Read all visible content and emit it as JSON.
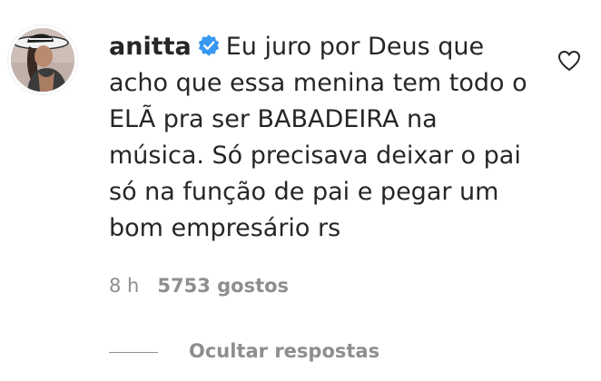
{
  "comment": {
    "username": "anitta",
    "avatar_icon": "user-avatar-photo",
    "verified_icon": "verified-badge-icon",
    "verified_color": "#3897f0",
    "lines": [
      "Eu juro por Deus que",
      "acho que essa menina tem todo o",
      "ELÃ pra ser BABADEIRA na",
      "música. Só precisava deixar o pai",
      "só na função de pai e pegar um",
      "bom empresário rs"
    ],
    "time": "8 h",
    "likes": "5753 gostos",
    "like_icon": "heart-outline-icon",
    "hide_replies_label": "Ocultar respostas"
  },
  "colors": {
    "text": "#262626",
    "secondary": "#8e8e8e",
    "background": "#ffffff"
  }
}
